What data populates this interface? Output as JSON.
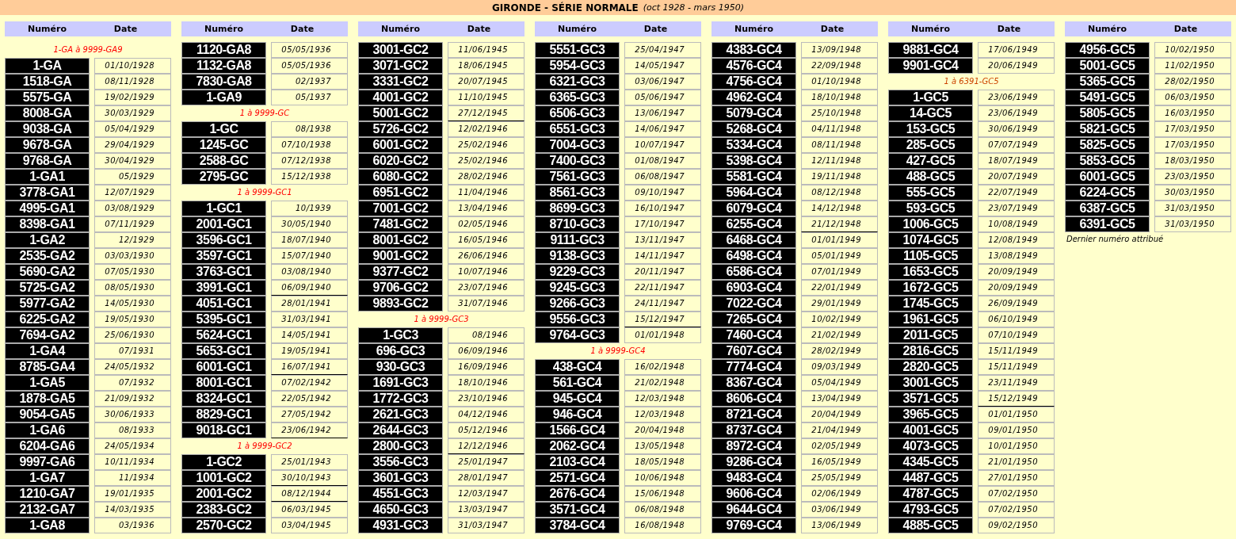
{
  "title": "GIRONDE - SÉRIE NORMALE",
  "subtitle": "(oct 1928 - mars 1950)",
  "columns": [
    {
      "headers": [
        "Numéro",
        "Date"
      ],
      "blocks": [
        {
          "kind": "series",
          "label": "1-GA à 9999-GA9",
          "color": "#ff0000"
        },
        {
          "kind": "plates",
          "rows": [
            {
              "number": "1-GA",
              "date": "01/10/1928",
              "year_end": false
            },
            {
              "number": "1518-GA",
              "date": "08/11/1928",
              "year_end": false
            },
            {
              "number": "5575-GA",
              "date": "19/02/1929",
              "year_end": false
            },
            {
              "number": "8008-GA",
              "date": "30/03/1929",
              "year_end": false
            },
            {
              "number": "9038-GA",
              "date": "05/04/1929",
              "year_end": false
            },
            {
              "number": "9678-GA",
              "date": "29/04/1929",
              "year_end": false
            },
            {
              "number": "9768-GA",
              "date": "30/04/1929",
              "year_end": false
            },
            {
              "number": "1-GA1",
              "date": "05/1929",
              "year_end": false
            },
            {
              "number": "3778-GA1",
              "date": "12/07/1929",
              "year_end": false
            },
            {
              "number": "4995-GA1",
              "date": "03/08/1929",
              "year_end": false
            },
            {
              "number": "8398-GA1",
              "date": "07/11/1929",
              "year_end": false
            },
            {
              "number": "1-GA2",
              "date": "12/1929",
              "year_end": false
            },
            {
              "number": "2535-GA2",
              "date": "03/03/1930",
              "year_end": false
            },
            {
              "number": "5690-GA2",
              "date": "07/05/1930",
              "year_end": false
            },
            {
              "number": "5725-GA2",
              "date": "08/05/1930",
              "year_end": false
            },
            {
              "number": "5977-GA2",
              "date": "14/05/1930",
              "year_end": false
            },
            {
              "number": "6225-GA2",
              "date": "19/05/1930",
              "year_end": false
            },
            {
              "number": "7694-GA2",
              "date": "25/06/1930",
              "year_end": false
            },
            {
              "number": "1-GA4",
              "date": "07/1931",
              "year_end": false
            },
            {
              "number": "8785-GA4",
              "date": "24/05/1932",
              "year_end": false
            },
            {
              "number": "1-GA5",
              "date": "07/1932",
              "year_end": false
            },
            {
              "number": "1878-GA5",
              "date": "21/09/1932",
              "year_end": false
            },
            {
              "number": "9054-GA5",
              "date": "30/06/1933",
              "year_end": false
            },
            {
              "number": "1-GA6",
              "date": "08/1933",
              "year_end": false
            },
            {
              "number": "6204-GA6",
              "date": "24/05/1934",
              "year_end": false
            },
            {
              "number": "9997-GA6",
              "date": "10/11/1934",
              "year_end": false
            },
            {
              "number": "1-GA7",
              "date": "11/1934",
              "year_end": false
            },
            {
              "number": "1210-GA7",
              "date": "19/01/1935",
              "year_end": false
            },
            {
              "number": "2132-GA7",
              "date": "14/03/1935",
              "year_end": false
            },
            {
              "number": "1-GA8",
              "date": "03/1936",
              "year_end": false
            }
          ]
        }
      ]
    },
    {
      "headers": [
        "Numéro",
        "Date"
      ],
      "blocks": [
        {
          "kind": "plates",
          "rows": [
            {
              "number": "1120-GA8",
              "date": "05/05/1936",
              "year_end": false
            },
            {
              "number": "1132-GA8",
              "date": "05/05/1936",
              "year_end": false
            },
            {
              "number": "7830-GA8",
              "date": "02/1937",
              "year_end": false
            },
            {
              "number": "1-GA9",
              "date": "05/1937",
              "year_end": false
            }
          ]
        },
        {
          "kind": "series",
          "label": "1 à 9999-GC",
          "color": "#ff0000"
        },
        {
          "kind": "plates",
          "rows": [
            {
              "number": "1-GC",
              "date": "08/1938",
              "year_end": false
            },
            {
              "number": "1245-GC",
              "date": "07/10/1938",
              "year_end": false
            },
            {
              "number": "2588-GC",
              "date": "07/12/1938",
              "year_end": false
            },
            {
              "number": "2795-GC",
              "date": "15/12/1938",
              "year_end": false
            }
          ]
        },
        {
          "kind": "series",
          "label": "1 à 9999-GC1",
          "color": "#ff0000"
        },
        {
          "kind": "plates",
          "rows": [
            {
              "number": "1-GC1",
              "date": "10/1939",
              "year_end": false
            },
            {
              "number": "2001-GC1",
              "date": "30/05/1940",
              "year_end": false
            },
            {
              "number": "3596-GC1",
              "date": "18/07/1940",
              "year_end": false
            },
            {
              "number": "3597-GC1",
              "date": "15/07/1940",
              "year_end": false
            },
            {
              "number": "3763-GC1",
              "date": "03/08/1940",
              "year_end": false
            },
            {
              "number": "3991-GC1",
              "date": "06/09/1940",
              "year_end": true
            },
            {
              "number": "4051-GC1",
              "date": "28/01/1941",
              "year_end": false
            },
            {
              "number": "5395-GC1",
              "date": "31/03/1941",
              "year_end": false
            },
            {
              "number": "5624-GC1",
              "date": "14/05/1941",
              "year_end": false
            },
            {
              "number": "5653-GC1",
              "date": "19/05/1941",
              "year_end": false
            },
            {
              "number": "6001-GC1",
              "date": "16/07/1941",
              "year_end": true
            },
            {
              "number": "8001-GC1",
              "date": "07/02/1942",
              "year_end": false
            },
            {
              "number": "8324-GC1",
              "date": "22/05/1942",
              "year_end": false
            },
            {
              "number": "8829-GC1",
              "date": "27/05/1942",
              "year_end": false
            },
            {
              "number": "9018-GC1",
              "date": "23/06/1942",
              "year_end": true
            }
          ]
        },
        {
          "kind": "series",
          "label": "1 à 9999-GC2",
          "color": "#ff0000"
        },
        {
          "kind": "plates",
          "rows": [
            {
              "number": "1-GC2",
              "date": "25/01/1943",
              "year_end": false
            },
            {
              "number": "1001-GC2",
              "date": "30/10/1943",
              "year_end": true
            },
            {
              "number": "2001-GC2",
              "date": "08/12/1944",
              "year_end": true
            },
            {
              "number": "2383-GC2",
              "date": "06/03/1945",
              "year_end": false
            },
            {
              "number": "2570-GC2",
              "date": "03/04/1945",
              "year_end": false
            }
          ]
        }
      ]
    },
    {
      "headers": [
        "Numéro",
        "Date"
      ],
      "blocks": [
        {
          "kind": "plates",
          "rows": [
            {
              "number": "3001-GC2",
              "date": "11/06/1945",
              "year_end": false
            },
            {
              "number": "3071-GC2",
              "date": "18/06/1945",
              "year_end": false
            },
            {
              "number": "3331-GC2",
              "date": "20/07/1945",
              "year_end": false
            },
            {
              "number": "4001-GC2",
              "date": "11/10/1945",
              "year_end": false
            },
            {
              "number": "5001-GC2",
              "date": "27/12/1945",
              "year_end": true
            },
            {
              "number": "5726-GC2",
              "date": "12/02/1946",
              "year_end": false
            },
            {
              "number": "6001-GC2",
              "date": "25/02/1946",
              "year_end": false
            },
            {
              "number": "6020-GC2",
              "date": "25/02/1946",
              "year_end": false
            },
            {
              "number": "6080-GC2",
              "date": "28/02/1946",
              "year_end": false
            },
            {
              "number": "6951-GC2",
              "date": "11/04/1946",
              "year_end": false
            },
            {
              "number": "7001-GC2",
              "date": "13/04/1946",
              "year_end": false
            },
            {
              "number": "7481-GC2",
              "date": "02/05/1946",
              "year_end": false
            },
            {
              "number": "8001-GC2",
              "date": "16/05/1946",
              "year_end": false
            },
            {
              "number": "9001-GC2",
              "date": "26/06/1946",
              "year_end": false
            },
            {
              "number": "9377-GC2",
              "date": "10/07/1946",
              "year_end": false
            },
            {
              "number": "9706-GC2",
              "date": "23/07/1946",
              "year_end": false
            },
            {
              "number": "9893-GC2",
              "date": "31/07/1946",
              "year_end": false
            }
          ]
        },
        {
          "kind": "series",
          "label": "1 à 9999-GC3",
          "color": "#ff0000"
        },
        {
          "kind": "plates",
          "rows": [
            {
              "number": "1-GC3",
              "date": "08/1946",
              "year_end": false
            },
            {
              "number": "696-GC3",
              "date": "06/09/1946",
              "year_end": false
            },
            {
              "number": "930-GC3",
              "date": "16/09/1946",
              "year_end": false
            },
            {
              "number": "1691-GC3",
              "date": "18/10/1946",
              "year_end": false
            },
            {
              "number": "1772-GC3",
              "date": "23/10/1946",
              "year_end": false
            },
            {
              "number": "2621-GC3",
              "date": "04/12/1946",
              "year_end": false
            },
            {
              "number": "2644-GC3",
              "date": "05/12/1946",
              "year_end": false
            },
            {
              "number": "2800-GC3",
              "date": "12/12/1946",
              "year_end": true
            },
            {
              "number": "3556-GC3",
              "date": "25/01/1947",
              "year_end": false
            },
            {
              "number": "3601-GC3",
              "date": "28/01/1947",
              "year_end": false
            },
            {
              "number": "4551-GC3",
              "date": "12/03/1947",
              "year_end": false
            },
            {
              "number": "4650-GC3",
              "date": "13/03/1947",
              "year_end": false
            },
            {
              "number": "4931-GC3",
              "date": "31/03/1947",
              "year_end": false
            }
          ]
        }
      ]
    },
    {
      "headers": [
        "Numéro",
        "Date"
      ],
      "blocks": [
        {
          "kind": "plates",
          "rows": [
            {
              "number": "5551-GC3",
              "date": "25/04/1947",
              "year_end": false
            },
            {
              "number": "5954-GC3",
              "date": "14/05/1947",
              "year_end": false
            },
            {
              "number": "6321-GC3",
              "date": "03/06/1947",
              "year_end": false
            },
            {
              "number": "6365-GC3",
              "date": "05/06/1947",
              "year_end": false
            },
            {
              "number": "6506-GC3",
              "date": "13/06/1947",
              "year_end": false
            },
            {
              "number": "6551-GC3",
              "date": "14/06/1947",
              "year_end": false
            },
            {
              "number": "7004-GC3",
              "date": "10/07/1947",
              "year_end": false
            },
            {
              "number": "7400-GC3",
              "date": "01/08/1947",
              "year_end": false
            },
            {
              "number": "7561-GC3",
              "date": "06/08/1947",
              "year_end": false
            },
            {
              "number": "8561-GC3",
              "date": "09/10/1947",
              "year_end": false
            },
            {
              "number": "8699-GC3",
              "date": "16/10/1947",
              "year_end": false
            },
            {
              "number": "8710-GC3",
              "date": "17/10/1947",
              "year_end": false
            },
            {
              "number": "9111-GC3",
              "date": "13/11/1947",
              "year_end": false
            },
            {
              "number": "9138-GC3",
              "date": "14/11/1947",
              "year_end": false
            },
            {
              "number": "9229-GC3",
              "date": "20/11/1947",
              "year_end": false
            },
            {
              "number": "9245-GC3",
              "date": "22/11/1947",
              "year_end": false
            },
            {
              "number": "9266-GC3",
              "date": "24/11/1947",
              "year_end": false
            },
            {
              "number": "9556-GC3",
              "date": "15/12/1947",
              "year_end": true
            },
            {
              "number": "9764-GC3",
              "date": "01/01/1948",
              "year_end": false
            }
          ]
        },
        {
          "kind": "series",
          "label": "1 à 9999-GC4",
          "color": "#ff0000"
        },
        {
          "kind": "plates",
          "rows": [
            {
              "number": "438-GC4",
              "date": "16/02/1948",
              "year_end": false
            },
            {
              "number": "561-GC4",
              "date": "21/02/1948",
              "year_end": false
            },
            {
              "number": "945-GC4",
              "date": "12/03/1948",
              "year_end": false
            },
            {
              "number": "946-GC4",
              "date": "12/03/1948",
              "year_end": false
            },
            {
              "number": "1566-GC4",
              "date": "20/04/1948",
              "year_end": false
            },
            {
              "number": "2062-GC4",
              "date": "13/05/1948",
              "year_end": false
            },
            {
              "number": "2103-GC4",
              "date": "18/05/1948",
              "year_end": false
            },
            {
              "number": "2571-GC4",
              "date": "10/06/1948",
              "year_end": false
            },
            {
              "number": "2676-GC4",
              "date": "15/06/1948",
              "year_end": false
            },
            {
              "number": "3571-GC4",
              "date": "06/08/1948",
              "year_end": false
            },
            {
              "number": "3784-GC4",
              "date": "16/08/1948",
              "year_end": false
            }
          ]
        }
      ]
    },
    {
      "headers": [
        "Numéro",
        "Date"
      ],
      "blocks": [
        {
          "kind": "plates",
          "rows": [
            {
              "number": "4383-GC4",
              "date": "13/09/1948",
              "year_end": false
            },
            {
              "number": "4576-GC4",
              "date": "22/09/1948",
              "year_end": false
            },
            {
              "number": "4756-GC4",
              "date": "01/10/1948",
              "year_end": false
            },
            {
              "number": "4962-GC4",
              "date": "18/10/1948",
              "year_end": false
            },
            {
              "number": "5079-GC4",
              "date": "25/10/1948",
              "year_end": false
            },
            {
              "number": "5268-GC4",
              "date": "04/11/1948",
              "year_end": false
            },
            {
              "number": "5334-GC4",
              "date": "08/11/1948",
              "year_end": false
            },
            {
              "number": "5398-GC4",
              "date": "12/11/1948",
              "year_end": false
            },
            {
              "number": "5581-GC4",
              "date": "19/11/1948",
              "year_end": false
            },
            {
              "number": "5964-GC4",
              "date": "08/12/1948",
              "year_end": false
            },
            {
              "number": "6079-GC4",
              "date": "14/12/1948",
              "year_end": false
            },
            {
              "number": "6255-GC4",
              "date": "21/12/1948",
              "year_end": true
            },
            {
              "number": "6468-GC4",
              "date": "01/01/1949",
              "year_end": false
            },
            {
              "number": "6498-GC4",
              "date": "05/01/1949",
              "year_end": false
            },
            {
              "number": "6586-GC4",
              "date": "07/01/1949",
              "year_end": false
            },
            {
              "number": "6903-GC4",
              "date": "22/01/1949",
              "year_end": false
            },
            {
              "number": "7022-GC4",
              "date": "29/01/1949",
              "year_end": false
            },
            {
              "number": "7265-GC4",
              "date": "10/02/1949",
              "year_end": false
            },
            {
              "number": "7460-GC4",
              "date": "21/02/1949",
              "year_end": false
            },
            {
              "number": "7607-GC4",
              "date": "28/02/1949",
              "year_end": false
            },
            {
              "number": "7774-GC4",
              "date": "09/03/1949",
              "year_end": false
            },
            {
              "number": "8367-GC4",
              "date": "05/04/1949",
              "year_end": false
            },
            {
              "number": "8606-GC4",
              "date": "13/04/1949",
              "year_end": false
            },
            {
              "number": "8721-GC4",
              "date": "20/04/1949",
              "year_end": false
            },
            {
              "number": "8737-GC4",
              "date": "21/04/1949",
              "year_end": false
            },
            {
              "number": "8972-GC4",
              "date": "02/05/1949",
              "year_end": false
            },
            {
              "number": "9286-GC4",
              "date": "16/05/1949",
              "year_end": false
            },
            {
              "number": "9483-GC4",
              "date": "25/05/1949",
              "year_end": false
            },
            {
              "number": "9606-GC4",
              "date": "02/06/1949",
              "year_end": false
            },
            {
              "number": "9644-GC4",
              "date": "03/06/1949",
              "year_end": false
            },
            {
              "number": "9769-GC4",
              "date": "13/06/1949",
              "year_end": false
            }
          ]
        }
      ]
    },
    {
      "headers": [
        "Numéro",
        "Date"
      ],
      "blocks": [
        {
          "kind": "plates",
          "rows": [
            {
              "number": "9881-GC4",
              "date": "17/06/1949",
              "year_end": false
            },
            {
              "number": "9901-GC4",
              "date": "20/06/1949",
              "year_end": false
            }
          ]
        },
        {
          "kind": "series",
          "label": "1 à 6391-GC5",
          "color": "#cc4400"
        },
        {
          "kind": "plates",
          "rows": [
            {
              "number": "1-GC5",
              "date": "23/06/1949",
              "year_end": false
            },
            {
              "number": "14-GC5",
              "date": "23/06/1949",
              "year_end": false
            },
            {
              "number": "153-GC5",
              "date": "30/06/1949",
              "year_end": false
            },
            {
              "number": "285-GC5",
              "date": "07/07/1949",
              "year_end": false
            },
            {
              "number": "427-GC5",
              "date": "18/07/1949",
              "year_end": false
            },
            {
              "number": "488-GC5",
              "date": "20/07/1949",
              "year_end": false
            },
            {
              "number": "555-GC5",
              "date": "22/07/1949",
              "year_end": false
            },
            {
              "number": "593-GC5",
              "date": "23/07/1949",
              "year_end": false
            },
            {
              "number": "1006-GC5",
              "date": "10/08/1949",
              "year_end": false
            },
            {
              "number": "1074-GC5",
              "date": "12/08/1949",
              "year_end": false
            },
            {
              "number": "1105-GC5",
              "date": "13/08/1949",
              "year_end": false
            },
            {
              "number": "1653-GC5",
              "date": "20/09/1949",
              "year_end": false
            },
            {
              "number": "1672-GC5",
              "date": "20/09/1949",
              "year_end": false
            },
            {
              "number": "1745-GC5",
              "date": "26/09/1949",
              "year_end": false
            },
            {
              "number": "1961-GC5",
              "date": "06/10/1949",
              "year_end": false
            },
            {
              "number": "2011-GC5",
              "date": "07/10/1949",
              "year_end": false
            },
            {
              "number": "2816-GC5",
              "date": "15/11/1949",
              "year_end": false
            },
            {
              "number": "2820-GC5",
              "date": "15/11/1949",
              "year_end": false
            },
            {
              "number": "3001-GC5",
              "date": "23/11/1949",
              "year_end": false
            },
            {
              "number": "3571-GC5",
              "date": "15/12/1949",
              "year_end": true
            },
            {
              "number": "3965-GC5",
              "date": "01/01/1950",
              "year_end": false
            },
            {
              "number": "4001-GC5",
              "date": "09/01/1950",
              "year_end": false
            },
            {
              "number": "4073-GC5",
              "date": "10/01/1950",
              "year_end": false
            },
            {
              "number": "4345-GC5",
              "date": "21/01/1950",
              "year_end": false
            },
            {
              "number": "4487-GC5",
              "date": "27/01/1950",
              "year_end": false
            },
            {
              "number": "4787-GC5",
              "date": "07/02/1950",
              "year_end": false
            },
            {
              "number": "4793-GC5",
              "date": "07/02/1950",
              "year_end": false
            },
            {
              "number": "4885-GC5",
              "date": "09/02/1950",
              "year_end": false
            }
          ]
        }
      ]
    },
    {
      "headers": [
        "Numéro",
        "Date"
      ],
      "blocks": [
        {
          "kind": "plates",
          "rows": [
            {
              "number": "4956-GC5",
              "date": "10/02/1950",
              "year_end": false
            },
            {
              "number": "5001-GC5",
              "date": "11/02/1950",
              "year_end": false
            },
            {
              "number": "5365-GC5",
              "date": "28/02/1950",
              "year_end": false
            },
            {
              "number": "5491-GC5",
              "date": "06/03/1950",
              "year_end": false
            },
            {
              "number": "5805-GC5",
              "date": "16/03/1950",
              "year_end": false
            },
            {
              "number": "5821-GC5",
              "date": "17/03/1950",
              "year_end": false
            },
            {
              "number": "5825-GC5",
              "date": "17/03/1950",
              "year_end": false
            },
            {
              "number": "5853-GC5",
              "date": "18/03/1950",
              "year_end": false
            },
            {
              "number": "6001-GC5",
              "date": "23/03/1950",
              "year_end": false
            },
            {
              "number": "6224-GC5",
              "date": "30/03/1950",
              "year_end": false
            },
            {
              "number": "6387-GC5",
              "date": "31/03/1950",
              "year_end": false
            },
            {
              "number": "6391-GC5",
              "date": "31/03/1950",
              "year_end": false
            }
          ]
        },
        {
          "kind": "note",
          "text": "Dernier numéro attribué"
        }
      ]
    }
  ]
}
